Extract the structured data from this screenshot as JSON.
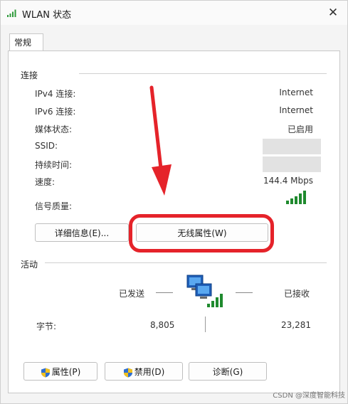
{
  "window": {
    "title": "WLAN 状态"
  },
  "tabs": [
    {
      "label": "常规"
    }
  ],
  "connection": {
    "section_label": "连接",
    "rows": [
      {
        "label": "IPv4 连接:",
        "value": "Internet"
      },
      {
        "label": "IPv6 连接:",
        "value": "Internet"
      },
      {
        "label": "媒体状态:",
        "value": "已启用"
      },
      {
        "label": "SSID:",
        "value": ""
      },
      {
        "label": "持续时间:",
        "value": ""
      },
      {
        "label": "速度:",
        "value": "144.4 Mbps"
      }
    ],
    "signal_label": "信号质量:",
    "buttons": {
      "details": "详细信息(E)...",
      "wireless_properties": "无线属性(W)"
    }
  },
  "activity": {
    "section_label": "活动",
    "sent_label": "已发送",
    "received_label": "已接收",
    "bytes_label": "字节:",
    "bytes_sent": "8,805",
    "bytes_received": "23,281"
  },
  "bottom_buttons": {
    "properties": "属性(P)",
    "disable": "禁用(D)",
    "diagnose": "诊断(G)"
  },
  "annotation_color": "#e5232a",
  "watermark": "CSDN @深度智能科技"
}
